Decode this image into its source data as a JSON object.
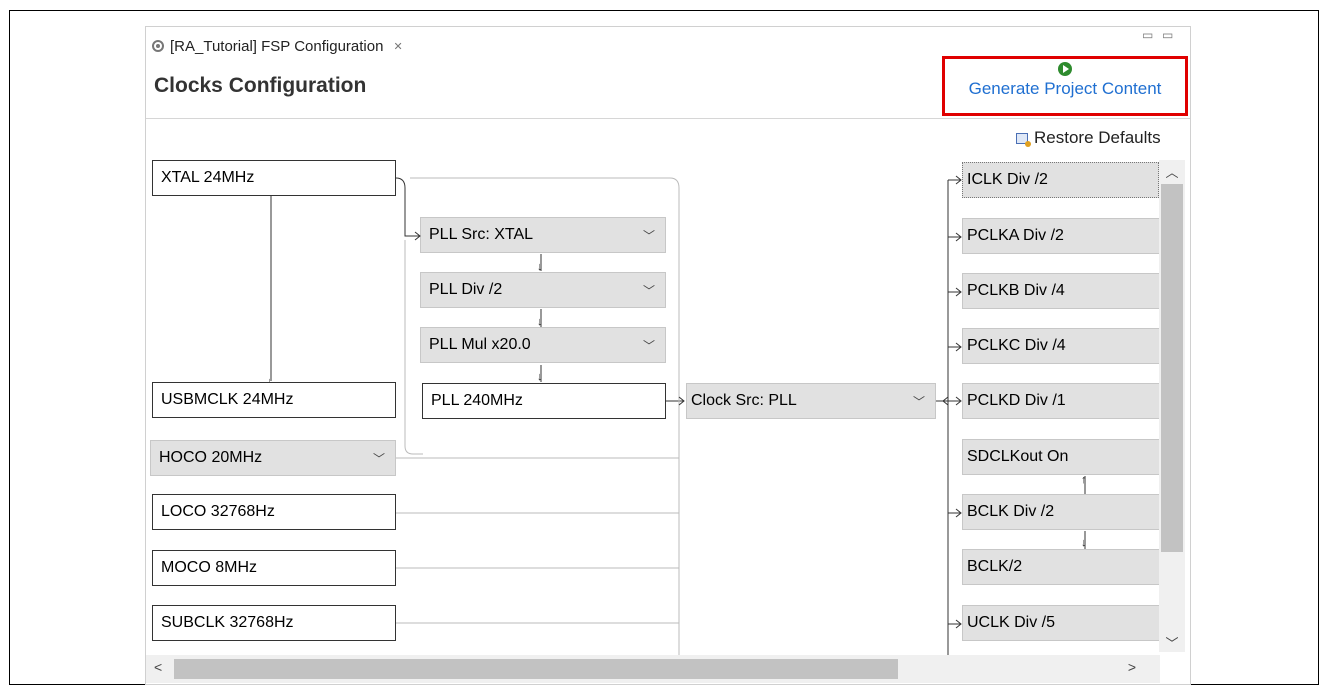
{
  "window": {
    "tab_title": "[RA_Tutorial] FSP Configuration",
    "tab_close": "✕",
    "minimize": "▭",
    "maximize": "▭"
  },
  "page_title": "Clocks Configuration",
  "toolbar": {
    "generate_label": "Generate Project Content",
    "restore_label": "Restore Defaults"
  },
  "sources": {
    "xtal": "XTAL 24MHz",
    "usbmclk": "USBMCLK 24MHz",
    "hoco": "HOCO 20MHz",
    "loco": "LOCO 32768Hz",
    "moco": "MOCO 8MHz",
    "subclk": "SUBCLK 32768Hz"
  },
  "pll": {
    "src": "PLL Src: XTAL",
    "div": "PLL Div /2",
    "mul": "PLL Mul x20.0",
    "out": "PLL 240MHz"
  },
  "clock_src": "Clock Src: PLL",
  "outputs": {
    "iclk": "ICLK Div /2",
    "pclka": "PCLKA Div /2",
    "pclkb": "PCLKB Div /4",
    "pclkc": "PCLKC Div /4",
    "pclkd": "PCLKD Div /1",
    "sdclkout": "SDCLKout On",
    "bclk": "BCLK Div /2",
    "bclk2": "BCLK/2",
    "uclk": "UCLK Div /5"
  },
  "icons": {
    "gear": "gear-icon",
    "play": "play-icon",
    "restore": "restore-defaults-icon",
    "chevron": "chevron-down-icon"
  },
  "colors": {
    "highlight_border": "#e00000",
    "link": "#1f6fd1",
    "dropdown_bg": "#e1e1e1"
  }
}
